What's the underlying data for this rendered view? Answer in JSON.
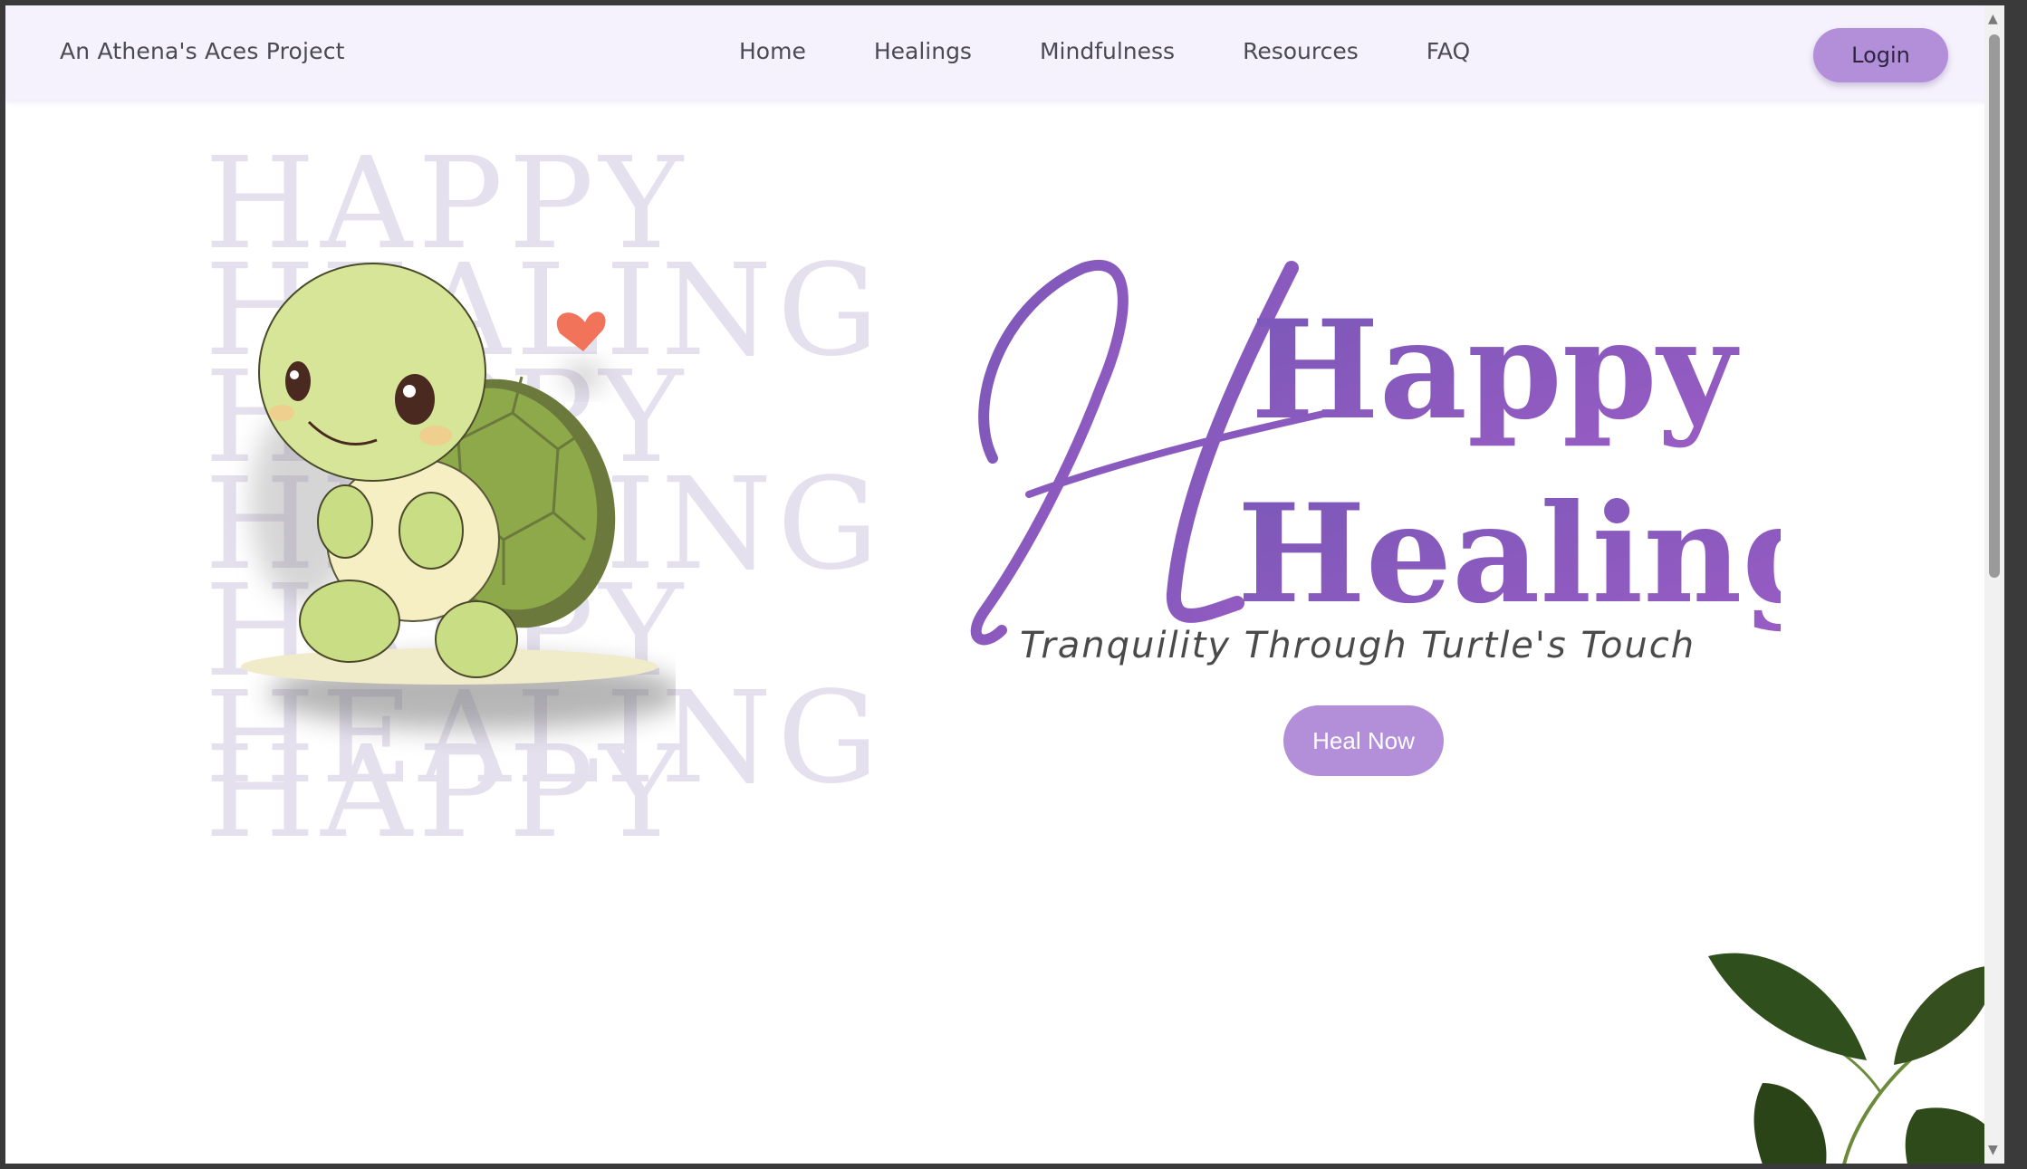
{
  "navbar": {
    "brand": "An Athena's Aces Project",
    "links": [
      "Home",
      "Healings",
      "Mindfulness",
      "Resources",
      "FAQ"
    ],
    "login_label": "Login"
  },
  "hero": {
    "background_words": [
      "HAPPY",
      "HEALING",
      "HAPPY",
      "HEALING",
      "HAPPY",
      "HEALING",
      "HAPPY"
    ],
    "logo_line1": "Happy",
    "logo_line2": "Healing",
    "tagline": "Tranquility Through Turtle's Touch",
    "cta_label": "Heal Now"
  },
  "colors": {
    "accent": "#b28fd8",
    "logo_purple": "#8a5cc0",
    "navbar_bg": "#f6f2fd"
  }
}
